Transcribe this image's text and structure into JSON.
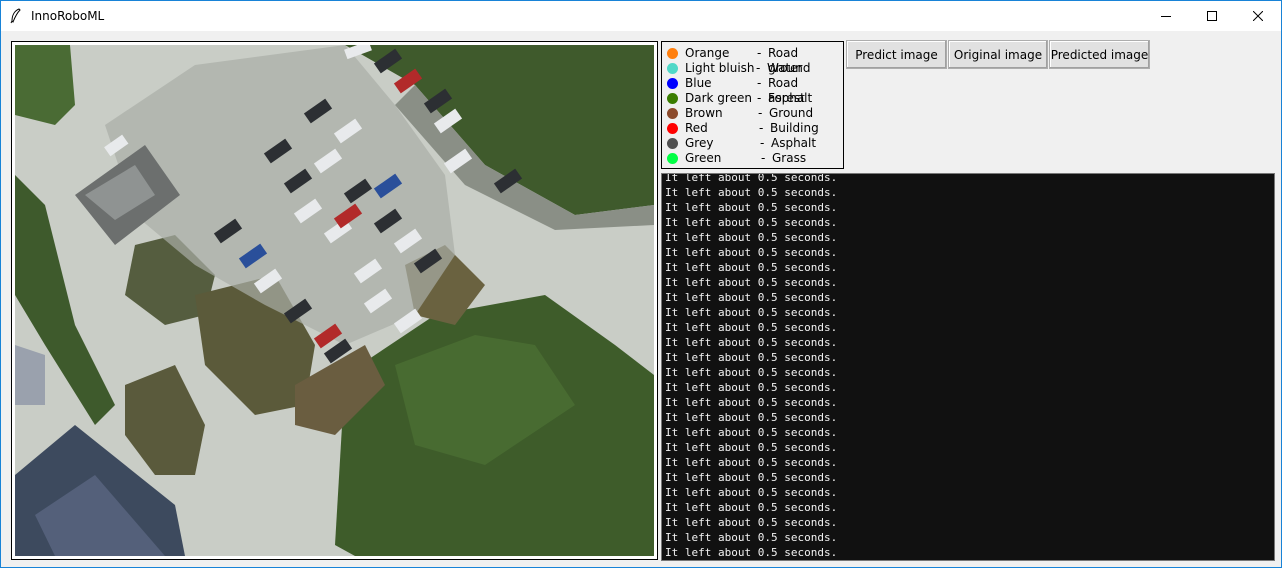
{
  "window": {
    "title": "InnoRoboML",
    "icons": {
      "app": "feather-icon",
      "minimize": "minimize-icon",
      "maximize": "maximize-icon",
      "close": "close-icon"
    }
  },
  "image_panel": {
    "content": "aerial-photo",
    "icon": "aerial-image"
  },
  "legend": {
    "items": [
      {
        "color_name": "Orange",
        "class_name": "Road ground",
        "color": "#ff7f0e"
      },
      {
        "color_name": "Light bluish",
        "class_name": "Water",
        "color": "#4fd8c8"
      },
      {
        "color_name": "Blue",
        "class_name": "Road asphalt",
        "color": "#0000ff"
      },
      {
        "color_name": "Dark green",
        "class_name": "Forest",
        "color": "#3a7d00"
      },
      {
        "color_name": "Brown",
        "class_name": "Ground",
        "color": "#8b4a2b"
      },
      {
        "color_name": "Red",
        "class_name": "Building",
        "color": "#ff0000"
      },
      {
        "color_name": "Grey",
        "class_name": "Asphalt",
        "color": "#505050"
      },
      {
        "color_name": "Green",
        "class_name": "Grass",
        "color": "#00ff44"
      }
    ],
    "separator": "-"
  },
  "buttons": {
    "predict": "Predict image",
    "original": "Original image",
    "predicted": "Predicted image"
  },
  "console": {
    "lines": [
      "It left about 0.5 seconds.",
      "It left about 0.5 seconds.",
      "It left about 0.5 seconds.",
      "It left about 0.5 seconds.",
      "It left about 0.5 seconds.",
      "It left about 0.5 seconds.",
      "It left about 0.5 seconds.",
      "It left about 0.5 seconds.",
      "It left about 0.5 seconds.",
      "It left about 0.5 seconds.",
      "It left about 0.5 seconds.",
      "It left about 0.5 seconds.",
      "It left about 0.5 seconds.",
      "It left about 0.5 seconds.",
      "It left about 0.5 seconds.",
      "It left about 0.5 seconds.",
      "It left about 0.5 seconds.",
      "It left about 0.5 seconds.",
      "It left about 0.5 seconds.",
      "It left about 0.5 seconds.",
      "It left about 0.5 seconds.",
      "It left about 0.5 seconds.",
      "It left about 0.5 seconds.",
      "It left about 0.5 seconds.",
      "It left about 0.5 seconds.",
      "It left about 0.5 seconds."
    ]
  }
}
